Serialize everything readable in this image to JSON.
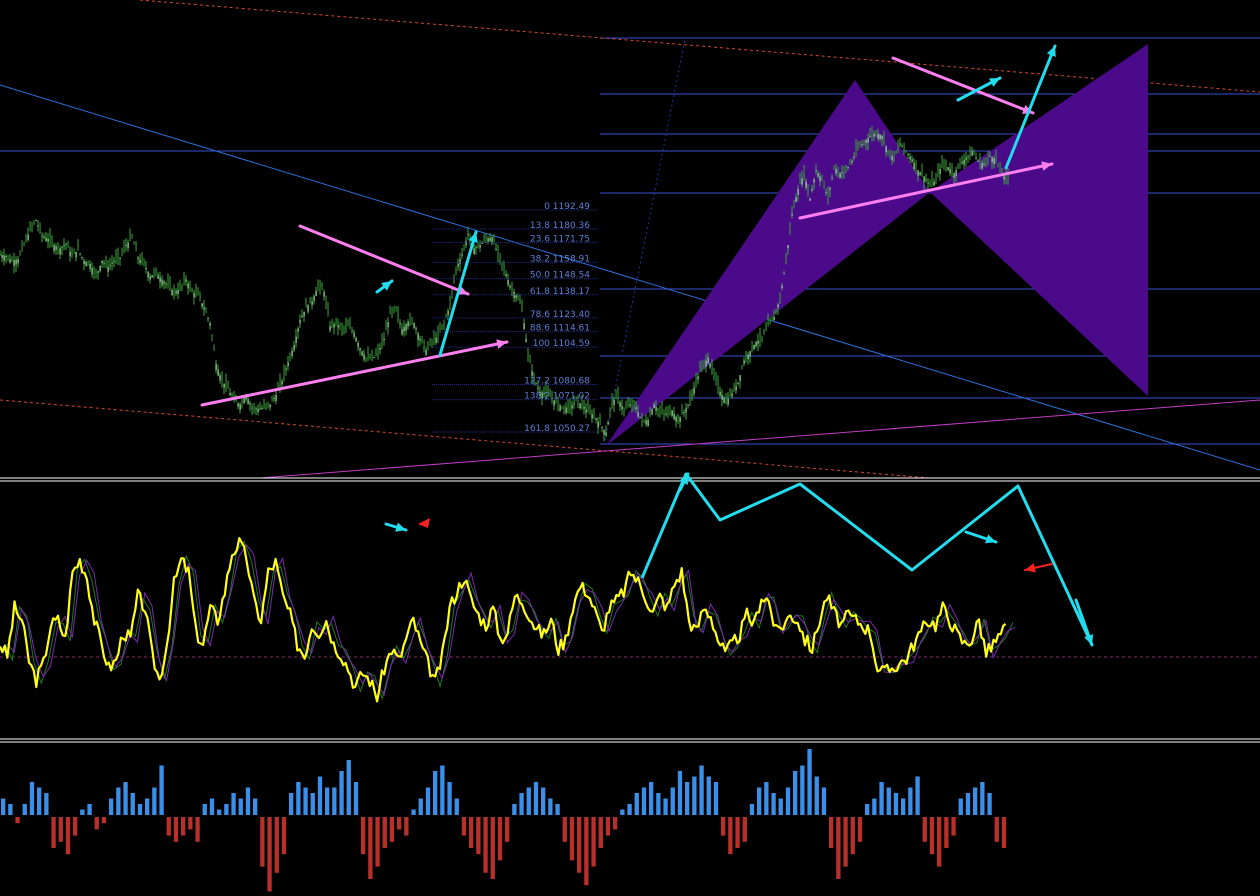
{
  "chart_data": [
    {
      "type": "candlestick",
      "title": "",
      "fib_levels": [
        {
          "ratio": "0",
          "price": "1192.49"
        },
        {
          "ratio": "13.8",
          "price": "1180.36"
        },
        {
          "ratio": "23.6",
          "price": "1171.75"
        },
        {
          "ratio": "38.2",
          "price": "1158.91"
        },
        {
          "ratio": "50.0",
          "price": "1148.54"
        },
        {
          "ratio": "61.8",
          "price": "1138.17"
        },
        {
          "ratio": "78.6",
          "price": "1123.40"
        },
        {
          "ratio": "88.6",
          "price": "1114.61"
        },
        {
          "ratio": "100",
          "price": "1104.59"
        },
        {
          "ratio": "127.2",
          "price": "1080.68"
        },
        {
          "ratio": "138.2",
          "price": "1071.02"
        },
        {
          "ratio": "161.8",
          "price": "1050.27"
        }
      ],
      "close_path": [
        [
          0,
          1164
        ],
        [
          6,
          1163
        ],
        [
          12,
          1160
        ],
        [
          18,
          1161
        ],
        [
          24,
          1170
        ],
        [
          30,
          1180
        ],
        [
          36,
          1186
        ],
        [
          42,
          1176
        ],
        [
          48,
          1174
        ],
        [
          54,
          1170
        ],
        [
          60,
          1168
        ],
        [
          66,
          1171
        ],
        [
          72,
          1163
        ],
        [
          78,
          1167
        ],
        [
          84,
          1160
        ],
        [
          90,
          1158
        ],
        [
          96,
          1150
        ],
        [
          102,
          1160
        ],
        [
          108,
          1156
        ],
        [
          114,
          1160
        ],
        [
          120,
          1162
        ],
        [
          126,
          1170
        ],
        [
          132,
          1175
        ],
        [
          138,
          1162
        ],
        [
          144,
          1158
        ],
        [
          150,
          1150
        ],
        [
          156,
          1152
        ],
        [
          162,
          1148
        ],
        [
          168,
          1144
        ],
        [
          174,
          1140
        ],
        [
          180,
          1142
        ],
        [
          186,
          1148
        ],
        [
          192,
          1140
        ],
        [
          198,
          1138
        ],
        [
          204,
          1130
        ],
        [
          210,
          1120
        ],
        [
          216,
          1094
        ],
        [
          222,
          1083
        ],
        [
          228,
          1078
        ],
        [
          234,
          1070
        ],
        [
          240,
          1068
        ],
        [
          246,
          1074
        ],
        [
          252,
          1066
        ],
        [
          258,
          1065
        ],
        [
          264,
          1066
        ],
        [
          270,
          1068
        ],
        [
          276,
          1074
        ],
        [
          282,
          1083
        ],
        [
          288,
          1095
        ],
        [
          294,
          1106
        ],
        [
          300,
          1122
        ],
        [
          306,
          1130
        ],
        [
          312,
          1134
        ],
        [
          318,
          1144
        ],
        [
          324,
          1140
        ],
        [
          330,
          1118
        ],
        [
          336,
          1120
        ],
        [
          342,
          1116
        ],
        [
          348,
          1118
        ],
        [
          354,
          1114
        ],
        [
          360,
          1104
        ],
        [
          366,
          1098
        ],
        [
          372,
          1097
        ],
        [
          378,
          1101
        ],
        [
          384,
          1110
        ],
        [
          390,
          1126
        ],
        [
          396,
          1128
        ],
        [
          402,
          1116
        ],
        [
          408,
          1121
        ],
        [
          414,
          1120
        ],
        [
          420,
          1110
        ],
        [
          426,
          1103
        ],
        [
          432,
          1108
        ],
        [
          438,
          1112
        ],
        [
          444,
          1120
        ],
        [
          450,
          1132
        ],
        [
          456,
          1155
        ],
        [
          462,
          1164
        ],
        [
          468,
          1177
        ],
        [
          474,
          1168
        ],
        [
          480,
          1170
        ],
        [
          486,
          1174
        ],
        [
          492,
          1175
        ],
        [
          498,
          1164
        ],
        [
          504,
          1155
        ],
        [
          510,
          1144
        ],
        [
          516,
          1138
        ],
        [
          522,
          1130
        ],
        [
          528,
          1100
        ],
        [
          534,
          1084
        ],
        [
          540,
          1076
        ],
        [
          546,
          1075
        ],
        [
          552,
          1072
        ],
        [
          558,
          1068
        ],
        [
          564,
          1066
        ],
        [
          570,
          1066
        ],
        [
          576,
          1070
        ],
        [
          582,
          1068
        ],
        [
          588,
          1063
        ],
        [
          594,
          1061
        ],
        [
          600,
          1055
        ],
        [
          606,
          1050
        ],
        [
          612,
          1070
        ],
        [
          618,
          1072
        ],
        [
          624,
          1064
        ],
        [
          630,
          1068
        ],
        [
          636,
          1066
        ],
        [
          642,
          1057
        ],
        [
          648,
          1058
        ],
        [
          654,
          1068
        ],
        [
          660,
          1063
        ],
        [
          666,
          1062
        ],
        [
          672,
          1064
        ],
        [
          678,
          1058
        ],
        [
          684,
          1063
        ],
        [
          690,
          1070
        ],
        [
          696,
          1083
        ],
        [
          702,
          1092
        ],
        [
          708,
          1098
        ],
        [
          714,
          1086
        ],
        [
          720,
          1076
        ],
        [
          726,
          1070
        ],
        [
          732,
          1075
        ],
        [
          738,
          1082
        ],
        [
          744,
          1096
        ],
        [
          750,
          1102
        ],
        [
          756,
          1108
        ],
        [
          762,
          1110
        ],
        [
          768,
          1118
        ],
        [
          774,
          1124
        ],
        [
          780,
          1136
        ],
        [
          786,
          1160
        ],
        [
          792,
          1190
        ],
        [
          798,
          1206
        ],
        [
          804,
          1216
        ],
        [
          810,
          1200
        ],
        [
          816,
          1218
        ],
        [
          822,
          1212
        ],
        [
          828,
          1200
        ],
        [
          834,
          1220
        ],
        [
          840,
          1216
        ],
        [
          846,
          1218
        ],
        [
          852,
          1224
        ],
        [
          858,
          1232
        ],
        [
          864,
          1236
        ],
        [
          870,
          1240
        ],
        [
          876,
          1242
        ],
        [
          882,
          1240
        ],
        [
          888,
          1230
        ],
        [
          894,
          1226
        ],
        [
          900,
          1235
        ],
        [
          906,
          1230
        ],
        [
          912,
          1225
        ],
        [
          918,
          1218
        ],
        [
          924,
          1214
        ],
        [
          930,
          1208
        ],
        [
          936,
          1212
        ],
        [
          942,
          1222
        ],
        [
          948,
          1220
        ],
        [
          954,
          1216
        ],
        [
          960,
          1222
        ],
        [
          966,
          1226
        ],
        [
          972,
          1230
        ],
        [
          978,
          1224
        ],
        [
          984,
          1222
        ],
        [
          990,
          1227
        ],
        [
          996,
          1225
        ],
        [
          1002,
          1215
        ],
        [
          1008,
          1212
        ]
      ]
    },
    {
      "type": "line",
      "series": [
        {
          "values": [
            0.4,
            0.35,
            0.55,
            0.5,
            0.33,
            0.25,
            0.32,
            0.48,
            0.5,
            0.42,
            0.7,
            0.75,
            0.68,
            0.5,
            0.4,
            0.3,
            0.33,
            0.45,
            0.42,
            0.6,
            0.55,
            0.35,
            0.25,
            0.4,
            0.65,
            0.75,
            0.7,
            0.45,
            0.4,
            0.55,
            0.5,
            0.62,
            0.78,
            0.82,
            0.76,
            0.58,
            0.5,
            0.7,
            0.74,
            0.6,
            0.52,
            0.4,
            0.35,
            0.48,
            0.45,
            0.5,
            0.4,
            0.36,
            0.3,
            0.22,
            0.28,
            0.25,
            0.18,
            0.3,
            0.38,
            0.33,
            0.42,
            0.5,
            0.4,
            0.32,
            0.24,
            0.35,
            0.55,
            0.62,
            0.68,
            0.58,
            0.52,
            0.48,
            0.55,
            0.42,
            0.45,
            0.6,
            0.58,
            0.52,
            0.46,
            0.44,
            0.5,
            0.38,
            0.42,
            0.56,
            0.64,
            0.62,
            0.54,
            0.45,
            0.55,
            0.58,
            0.62,
            0.7,
            0.66,
            0.6,
            0.53,
            0.6,
            0.55,
            0.65,
            0.7,
            0.5,
            0.45,
            0.55,
            0.52,
            0.42,
            0.36,
            0.4,
            0.44,
            0.52,
            0.48,
            0.6,
            0.58,
            0.45,
            0.48,
            0.52,
            0.5,
            0.42,
            0.38,
            0.5,
            0.6,
            0.53,
            0.48,
            0.52,
            0.5,
            0.48,
            0.45,
            0.3,
            0.28,
            0.3,
            0.32,
            0.34,
            0.4,
            0.45,
            0.5,
            0.48,
            0.55,
            0.5,
            0.44,
            0.4,
            0.42,
            0.5,
            0.36,
            0.4,
            0.44,
            0.48
          ]
        }
      ]
    },
    {
      "type": "bar",
      "values": [
        0.3,
        0.2,
        -0.1,
        0.2,
        0.6,
        0.5,
        0.4,
        -0.5,
        -0.4,
        -0.6,
        -0.3,
        0.1,
        0.2,
        -0.2,
        -0.1,
        0.3,
        0.5,
        0.6,
        0.4,
        0.2,
        0.3,
        0.5,
        0.9,
        -0.3,
        -0.4,
        -0.3,
        -0.2,
        -0.4,
        0.2,
        0.3,
        0.1,
        0.2,
        0.4,
        0.3,
        0.5,
        0.3,
        -0.8,
        -1.2,
        -0.9,
        -0.6,
        0.4,
        0.6,
        0.5,
        0.4,
        0.7,
        0.5,
        0.5,
        0.8,
        1.0,
        0.6,
        -0.6,
        -1.0,
        -0.8,
        -0.5,
        -0.4,
        -0.2,
        -0.3,
        0.1,
        0.3,
        0.5,
        0.8,
        0.9,
        0.6,
        0.3,
        -0.3,
        -0.5,
        -0.6,
        -0.9,
        -1.0,
        -0.7,
        -0.4,
        0.2,
        0.4,
        0.5,
        0.6,
        0.5,
        0.3,
        0.2,
        -0.4,
        -0.7,
        -0.9,
        -1.1,
        -0.8,
        -0.5,
        -0.3,
        -0.2,
        0.1,
        0.2,
        0.4,
        0.5,
        0.6,
        0.4,
        0.3,
        0.5,
        0.8,
        0.6,
        0.7,
        0.9,
        0.7,
        0.6,
        -0.3,
        -0.6,
        -0.5,
        -0.4,
        0.2,
        0.5,
        0.6,
        0.4,
        0.3,
        0.5,
        0.8,
        0.9,
        1.2,
        0.7,
        0.5,
        -0.5,
        -1.0,
        -0.8,
        -0.6,
        -0.4,
        0.2,
        0.3,
        0.6,
        0.5,
        0.4,
        0.3,
        0.5,
        0.7,
        -0.4,
        -0.6,
        -0.8,
        -0.5,
        -0.3,
        0.3,
        0.4,
        0.5,
        0.6,
        0.4,
        -0.4,
        -0.5
      ]
    }
  ]
}
